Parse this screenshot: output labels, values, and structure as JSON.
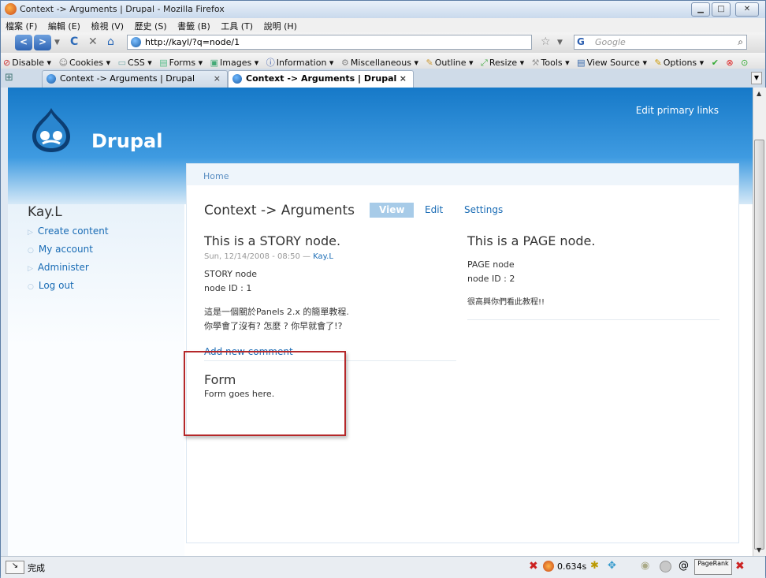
{
  "window": {
    "title": "Context -> Arguments | Drupal - Mozilla Firefox"
  },
  "menu": [
    "檔案 (F)",
    "編輯 (E)",
    "檢視 (V)",
    "歷史 (S)",
    "書籤 (B)",
    "工具 (T)",
    "說明 (H)"
  ],
  "nav": {
    "url": "http://kayl/?q=node/1",
    "search_placeholder": "Google",
    "search_engine_glyph": "G"
  },
  "devtoolbar": [
    "Disable",
    "Cookies",
    "CSS",
    "Forms",
    "Images",
    "Information",
    "Miscellaneous",
    "Outline",
    "Resize",
    "Tools",
    "View Source",
    "Options"
  ],
  "tabs": [
    {
      "label": "Context -> Arguments | Drupal",
      "active": false
    },
    {
      "label": "Context -> Arguments | Drupal",
      "active": true
    }
  ],
  "site": {
    "name": "Drupal",
    "edit_primary_links": "Edit primary links"
  },
  "sidebar": {
    "user": "Kay.L",
    "links": [
      "Create content",
      "My account",
      "Administer",
      "Log out"
    ]
  },
  "breadcrumb": "Home",
  "page": {
    "title": "Context -> Arguments",
    "tab_view": "View",
    "tab_edit": "Edit",
    "tab_settings": "Settings",
    "story": {
      "heading": "This is a STORY node.",
      "date": "Sun, 12/14/2008 - 08:50",
      "sep": " — ",
      "author": "Kay.L",
      "line1": "STORY node",
      "line2": "node ID : 1",
      "line3": "這是一個關於Panels 2.x 的簡單教程.",
      "line4": "你學會了沒有? 怎麼 ? 你早就會了!?",
      "add_comment": "Add new comment"
    },
    "page_node": {
      "heading": "This is a PAGE node.",
      "line1": "PAGE node",
      "line2": "node ID : 2",
      "line3": "很高興你們看此教程!!"
    },
    "form": {
      "heading": "Form",
      "text": "Form goes here."
    }
  },
  "status": {
    "text": "完成",
    "timing": "0.634s",
    "pagerank": "PageRank"
  },
  "colors": {
    "header_blue": "#1679c8",
    "link_blue": "#1a6cb5",
    "highlight_red": "#b5282a"
  }
}
